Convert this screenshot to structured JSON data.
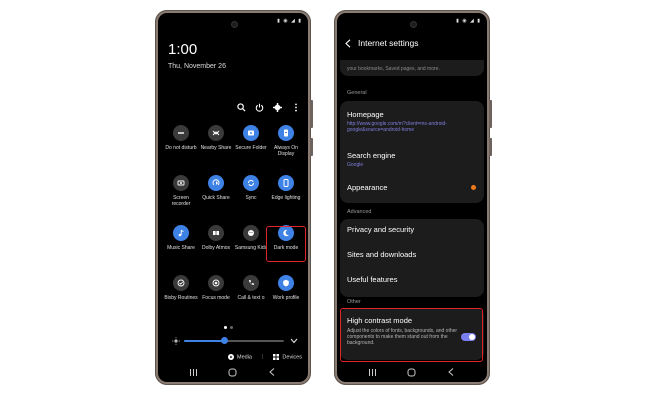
{
  "left_phone": {
    "time": "1:00",
    "date": "Thu, November 26",
    "tools": [
      "search-icon",
      "power-icon",
      "gear-icon",
      "more-icon"
    ],
    "tiles": [
      {
        "label": "Do not disturb",
        "icon": "minus-circle-icon",
        "on": false
      },
      {
        "label": "Nearby Share",
        "icon": "nearby-share-icon",
        "on": false
      },
      {
        "label": "Secure Folder",
        "icon": "folder-lock-icon",
        "on": true
      },
      {
        "label": "Always On Display",
        "icon": "aod-clock-icon",
        "on": true
      },
      {
        "label": "Screen recorder",
        "icon": "screen-record-icon",
        "on": false
      },
      {
        "label": "Quick Share",
        "icon": "quick-share-icon",
        "on": true
      },
      {
        "label": "Sync",
        "icon": "sync-icon",
        "on": true
      },
      {
        "label": "Edge lighting",
        "icon": "edge-lighting-icon",
        "on": true
      },
      {
        "label": "Music Share",
        "icon": "music-icon",
        "on": true
      },
      {
        "label": "Dolby Atmos",
        "icon": "dolby-icon",
        "on": false
      },
      {
        "label": "Samsung Kids",
        "icon": "kids-icon",
        "on": false
      },
      {
        "label": "Dark mode",
        "icon": "moon-icon",
        "on": true
      },
      {
        "label": "Bixby Routines",
        "icon": "check-circle-icon",
        "on": false
      },
      {
        "label": "Focus mode",
        "icon": "focus-icon",
        "on": false
      },
      {
        "label": "Call & text o",
        "icon": "phone-icon",
        "on": false
      },
      {
        "label": "Work profile",
        "icon": "briefcase-icon",
        "on": true
      }
    ],
    "brightness_level": 0.4,
    "media_label": "Media",
    "devices_label": "Devices"
  },
  "right_phone": {
    "title": "Internet settings",
    "top_fragment": "your bookmarks, Saved pages, and more.",
    "section_general": "General",
    "homepage_title": "Homepage",
    "homepage_url": "http://www.google.com/m?client=ms-android-google&source=android-home",
    "search_title": "Search engine",
    "search_value": "Google",
    "appearance_title": "Appearance",
    "section_advanced": "Advanced",
    "privacy_title": "Privacy and security",
    "sites_title": "Sites and downloads",
    "useful_title": "Useful features",
    "section_other": "Other",
    "hc_title": "High contrast mode",
    "hc_desc": "Adjust the colors of fonts, backgrounds, and other components to make them stand out from the background.",
    "hc_enabled": true
  },
  "colors": {
    "accent_blue": "#3e82e6",
    "highlight_red": "#e0242b",
    "link_purple": "#7f7fe0",
    "badge_orange": "#f07a1a"
  }
}
